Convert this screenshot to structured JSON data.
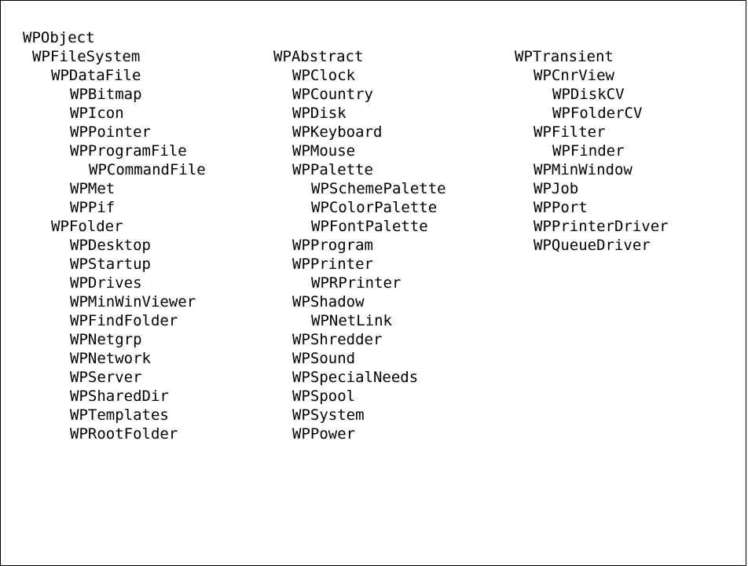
{
  "root": "WPObject",
  "columns": [
    {
      "nodes": [
        {
          "label": "WPFileSystem",
          "level": 1
        },
        {
          "label": "WPDataFile",
          "level": 2
        },
        {
          "label": "WPBitmap",
          "level": 3
        },
        {
          "label": "WPIcon",
          "level": 3
        },
        {
          "label": "WPPointer",
          "level": 3
        },
        {
          "label": "WPProgramFile",
          "level": 3
        },
        {
          "label": "WPCommandFile",
          "level": 4
        },
        {
          "label": "WPMet",
          "level": 3
        },
        {
          "label": "WPPif",
          "level": 3
        },
        {
          "label": "WPFolder",
          "level": 2
        },
        {
          "label": "WPDesktop",
          "level": 3
        },
        {
          "label": "WPStartup",
          "level": 3
        },
        {
          "label": "WPDrives",
          "level": 3
        },
        {
          "label": "WPMinWinViewer",
          "level": 3
        },
        {
          "label": "WPFindFolder",
          "level": 3
        },
        {
          "label": "WPNetgrp",
          "level": 3
        },
        {
          "label": "WPNetwork",
          "level": 3
        },
        {
          "label": "WPServer",
          "level": 3
        },
        {
          "label": "WPSharedDir",
          "level": 3
        },
        {
          "label": "WPTemplates",
          "level": 3
        },
        {
          "label": "WPRootFolder",
          "level": 3
        }
      ]
    },
    {
      "nodes": [
        {
          "label": "WPAbstract",
          "level": 1
        },
        {
          "label": "WPClock",
          "level": 2
        },
        {
          "label": "WPCountry",
          "level": 2
        },
        {
          "label": "WPDisk",
          "level": 2
        },
        {
          "label": "WPKeyboard",
          "level": 2
        },
        {
          "label": "WPMouse",
          "level": 2
        },
        {
          "label": "WPPalette",
          "level": 2
        },
        {
          "label": "WPSchemePalette",
          "level": 3
        },
        {
          "label": "WPColorPalette",
          "level": 3
        },
        {
          "label": "WPFontPalette",
          "level": 3
        },
        {
          "label": "WPProgram",
          "level": 2
        },
        {
          "label": "WPPrinter",
          "level": 2
        },
        {
          "label": "WPRPrinter",
          "level": 3
        },
        {
          "label": "WPShadow",
          "level": 2
        },
        {
          "label": "WPNetLink",
          "level": 3
        },
        {
          "label": "WPShredder",
          "level": 2
        },
        {
          "label": "WPSound",
          "level": 2
        },
        {
          "label": "WPSpecialNeeds",
          "level": 2
        },
        {
          "label": "WPSpool",
          "level": 2
        },
        {
          "label": "WPSystem",
          "level": 2
        },
        {
          "label": "WPPower",
          "level": 2
        }
      ]
    },
    {
      "nodes": [
        {
          "label": "WPTransient",
          "level": 1
        },
        {
          "label": "WPCnrView",
          "level": 2
        },
        {
          "label": "WPDiskCV",
          "level": 3
        },
        {
          "label": "WPFolderCV",
          "level": 3
        },
        {
          "label": "WPFilter",
          "level": 2
        },
        {
          "label": "WPFinder",
          "level": 3
        },
        {
          "label": "WPMinWindow",
          "level": 2
        },
        {
          "label": "WPJob",
          "level": 2
        },
        {
          "label": "WPPort",
          "level": 2
        },
        {
          "label": "WPPrinterDriver",
          "level": 2
        },
        {
          "label": "WPQueueDriver",
          "level": 2
        }
      ]
    }
  ]
}
